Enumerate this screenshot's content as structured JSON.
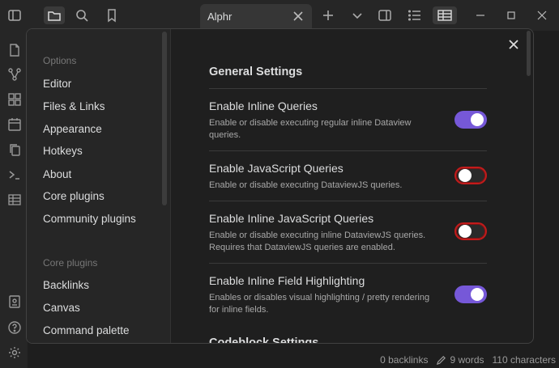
{
  "tab": {
    "title": "Alphr"
  },
  "modal": {
    "sidebar": {
      "options_heading": "Options",
      "options_items": [
        "Editor",
        "Files & Links",
        "Appearance",
        "Hotkeys",
        "About",
        "Core plugins",
        "Community plugins"
      ],
      "core_heading": "Core plugins",
      "core_items": [
        "Backlinks",
        "Canvas",
        "Command palette"
      ]
    },
    "general_heading": "General Settings",
    "settings": [
      {
        "name": "Enable Inline Queries",
        "desc": "Enable or disable executing regular inline Dataview queries.",
        "enabled": true
      },
      {
        "name": "Enable JavaScript Queries",
        "desc": "Enable or disable executing DataviewJS queries.",
        "enabled": false
      },
      {
        "name": "Enable Inline JavaScript Queries",
        "desc": "Enable or disable executing inline DataviewJS queries. Requires that DataviewJS queries are enabled.",
        "enabled": false
      },
      {
        "name": "Enable Inline Field Highlighting",
        "desc": "Enables or disables visual highlighting / pretty rendering for inline fields.",
        "enabled": true
      }
    ],
    "codeblock_heading": "Codeblock Settings"
  },
  "status": {
    "backlinks": "0 backlinks",
    "words": "9 words",
    "characters": "110 characters"
  },
  "colors": {
    "accent": "#7658d8",
    "highlight_border": "#c21b1b"
  },
  "icons": {
    "titlebar": [
      "sidebar-toggle-icon",
      "folder-icon",
      "search-icon",
      "bookmark-icon",
      "plus-icon",
      "chevron-down-icon",
      "split-pane-icon",
      "list-icon",
      "table-icon",
      "minimize-icon",
      "maximize-icon",
      "close-icon"
    ],
    "ribbon": [
      "file-icon",
      "graph-icon",
      "canvas-icon",
      "calendar-icon",
      "copy-icon",
      "terminal-icon",
      "table-icon",
      "vault-icon",
      "help-icon",
      "settings-icon"
    ]
  }
}
